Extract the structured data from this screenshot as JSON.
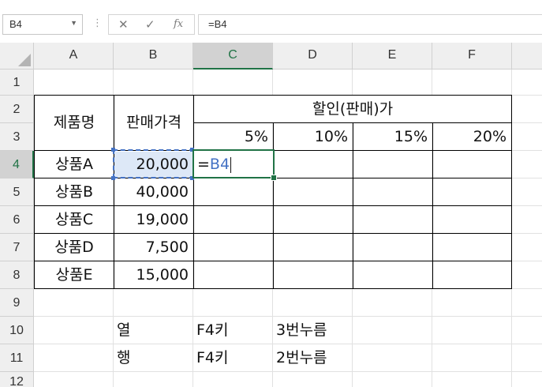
{
  "name_box": "B4",
  "formula_bar": {
    "content": "=B4",
    "fx_label": "fx"
  },
  "columns": [
    "A",
    "B",
    "C",
    "D",
    "E",
    "F"
  ],
  "rows": [
    "1",
    "2",
    "3",
    "4",
    "5",
    "6",
    "7",
    "8",
    "9",
    "10",
    "11",
    "12"
  ],
  "table": {
    "header_product": "제품명",
    "header_price": "판매가격",
    "header_discount": "할인(판매)가",
    "rates": [
      "5%",
      "10%",
      "15%",
      "20%"
    ],
    "products": [
      "상품A",
      "상품B",
      "상품C",
      "상품D",
      "상품E"
    ],
    "prices": [
      "20,000",
      "40,000",
      "19,000",
      "7,500",
      "15,000"
    ]
  },
  "editing": {
    "eq": "=",
    "ref": "B4"
  },
  "notes": [
    {
      "label": "열",
      "key": "F4키",
      "desc": "3번누름"
    },
    {
      "label": "행",
      "key": "F4키",
      "desc": "2번누름"
    }
  ],
  "colors": {
    "selection_green": "#217346",
    "ref_blue": "#4472c4",
    "ref_fill": "#dde8f7"
  }
}
